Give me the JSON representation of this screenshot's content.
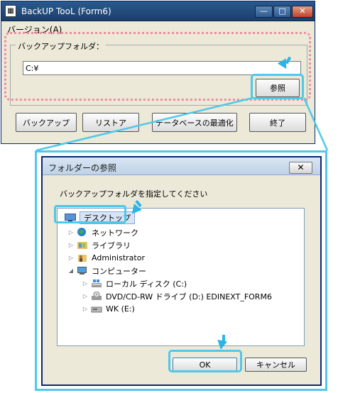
{
  "main_window": {
    "title": "BackUP TooL (Form6)",
    "menu": {
      "version": "バージョン(A)"
    },
    "backup_folder_label": "バックアップフォルダ：",
    "backup_folder_value": "C:¥",
    "browse_label": "参照",
    "buttons": {
      "backup": "バックアップ",
      "restore": "リストア",
      "optimize": "データベースの最適化",
      "exit": "終了"
    }
  },
  "dialog": {
    "title": "フォルダーの参照",
    "instruction": "バックアップフォルダを指定してください",
    "tree": [
      {
        "label": "デスクトップ",
        "icon": "desktop-icon",
        "selected": true
      },
      {
        "label": "ネットワーク",
        "icon": "network-icon"
      },
      {
        "label": "ライブラリ",
        "icon": "library-icon"
      },
      {
        "label": "Administrator",
        "icon": "user-icon"
      },
      {
        "label": "コンピューター",
        "icon": "computer-icon",
        "expanded": true
      },
      {
        "label": "ローカル ディスク (C:)",
        "icon": "local-disk-icon"
      },
      {
        "label": "DVD/CD-RW ドライブ (D:) EDINEXT_FORM6",
        "icon": "dvd-drive-icon"
      },
      {
        "label": "WK (E:)",
        "icon": "removable-drive-icon"
      }
    ],
    "ok_label": "OK",
    "cancel_label": "キャンセル"
  },
  "colors": {
    "highlight_callout": "#4fc8ea",
    "highlight_dotted": "#f08ca0",
    "window_title": "#1c3f6b"
  }
}
